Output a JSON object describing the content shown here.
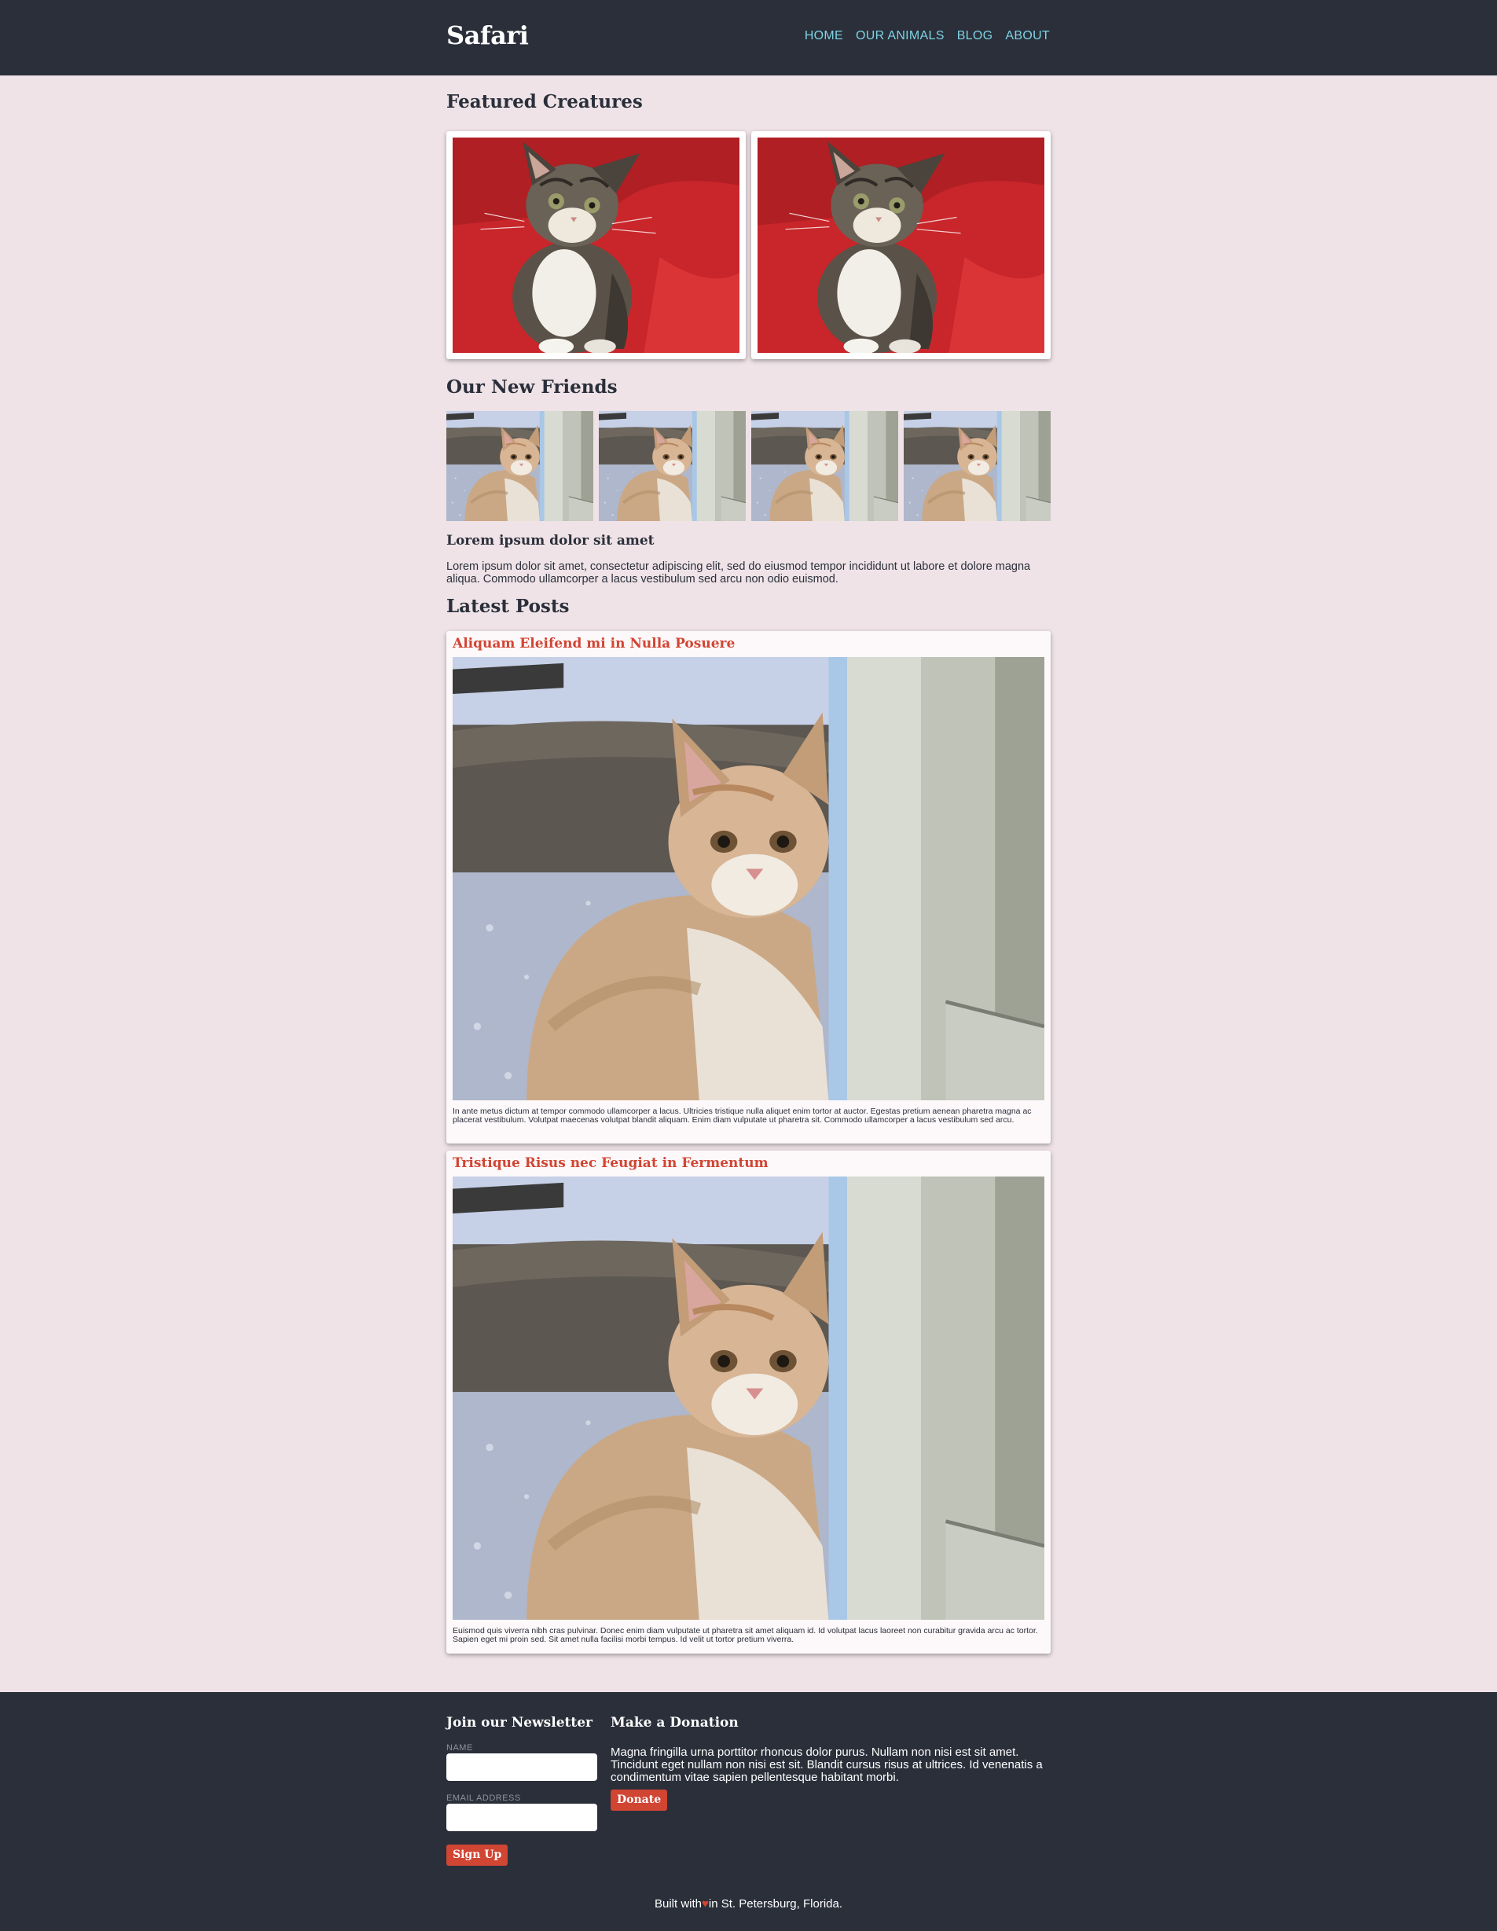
{
  "header": {
    "logo": "Safari",
    "nav": [
      "HOME",
      "OUR ANIMALS",
      "BLOG",
      "ABOUT"
    ]
  },
  "featured": {
    "title": "Featured Creatures"
  },
  "friends": {
    "title": "Our New Friends"
  },
  "intro": {
    "title": "Lorem ipsum dolor sit amet",
    "text": "Lorem ipsum dolor sit amet, consectetur adipiscing elit, sed do eiusmod tempor incididunt ut labore et dolore magna aliqua. Commodo ullamcorper a lacus vestibulum sed arcu non odio euismod."
  },
  "posts": {
    "title": "Latest Posts",
    "items": [
      {
        "title": "Aliquam Eleifend mi in Nulla Posuere",
        "text": "In ante metus dictum at tempor commodo ullamcorper a lacus. Ultricies tristique nulla aliquet enim tortor at auctor. Egestas pretium aenean pharetra magna ac placerat vestibulum. Volutpat maecenas volutpat blandit aliquam. Enim diam vulputate ut pharetra sit. Commodo ullamcorper a lacus vestibulum sed arcu."
      },
      {
        "title": "Tristique Risus nec Feugiat in Fermentum",
        "text": "Euismod quis viverra nibh cras pulvinar. Donec enim diam vulputate ut pharetra sit amet aliquam id. Id volutpat lacus laoreet non curabitur gravida arcu ac tortor. Sapien eget mi proin sed. Sit amet nulla facilisi morbi tempus. Id velit ut tortor pretium viverra."
      }
    ]
  },
  "footer": {
    "newsletter": {
      "title": "Join our Newsletter",
      "name_label": "NAME",
      "email_label": "EMAIL ADDRESS",
      "button": "Sign Up"
    },
    "donation": {
      "title": "Make a Donation",
      "text": "Magna fringilla urna porttitor rhoncus dolor purus. Nullam non nisi est sit amet. Tincidunt eget nullam non nisi est sit. Blandit cursus risus at ultrices. Id venenatis a condimentum vitae sapien pellentesque habitant morbi.",
      "button": "Donate"
    },
    "credit_before": "Built with",
    "credit_heart": "♥",
    "credit_after": "in St. Petersburg, Florida."
  },
  "colors": {
    "header_bg": "#2a2f3a",
    "page_bg": "#efe3e7",
    "nav_link": "#7fd3e4",
    "accent": "#d14533"
  },
  "icons": {
    "heart": "heart-icon"
  }
}
